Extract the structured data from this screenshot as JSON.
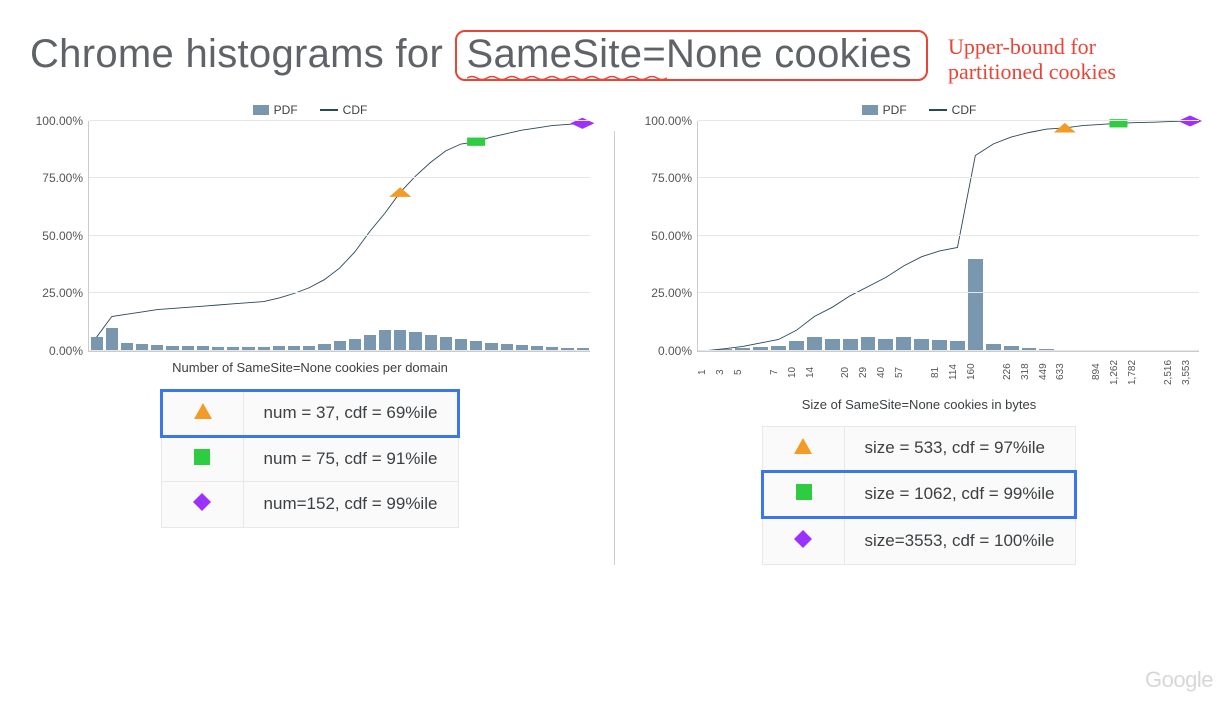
{
  "title_prefix": "Chrome histograms for ",
  "title_box": "SameSite=None cookies",
  "annotation_l1": "Upper-bound for",
  "annotation_l2": "partitioned cookies",
  "legend_pdf": "PDF",
  "legend_cdf": "CDF",
  "left": {
    "subtitle": "Number of SameSite=None cookies per domain",
    "rows": [
      {
        "label": "num = 37, cdf = 69%ile"
      },
      {
        "label": "num = 75, cdf = 91%ile"
      },
      {
        "label": "num=152, cdf = 99%ile"
      }
    ]
  },
  "right": {
    "subtitle": "Size of SameSite=None cookies in bytes",
    "rows": [
      {
        "label": "size = 533, cdf = 97%ile"
      },
      {
        "label": "size = 1062, cdf = 99%ile"
      },
      {
        "label": "size=3553, cdf = 100%ile"
      }
    ]
  },
  "yticks": [
    "0.00%",
    "25.00%",
    "50.00%",
    "75.00%",
    "100.00%"
  ],
  "logo": "Google",
  "chart_data": [
    {
      "type": "bar+line",
      "title": "Number of SameSite=None cookies per domain",
      "ylabel": "%",
      "ylim": [
        0,
        100
      ],
      "series": [
        {
          "name": "PDF",
          "type": "bar",
          "values": [
            6,
            10,
            3.5,
            3,
            2.5,
            2,
            2,
            2,
            1.5,
            1.5,
            1.5,
            1.5,
            2,
            2,
            2,
            3,
            4,
            5,
            7,
            9,
            9,
            8,
            7,
            6,
            5,
            4,
            3.5,
            3,
            2.5,
            2,
            1.5,
            1,
            1
          ]
        },
        {
          "name": "CDF",
          "type": "line",
          "values": [
            6,
            15,
            16,
            17,
            18,
            18.5,
            19,
            19.5,
            20,
            20.5,
            21,
            21.5,
            23,
            25,
            27.5,
            31,
            36,
            43,
            52,
            60,
            69,
            76,
            82,
            87,
            90,
            91,
            93,
            94.5,
            96,
            97,
            98,
            98.5,
            99
          ]
        }
      ],
      "markers": [
        {
          "shape": "triangle",
          "color": "#f29b26",
          "x_index": 20,
          "y": 69,
          "label": "num = 37, cdf = 69%ile"
        },
        {
          "shape": "square",
          "color": "#2ecc40",
          "x_index": 25,
          "y": 91,
          "label": "num = 75, cdf = 91%ile"
        },
        {
          "shape": "diamond",
          "color": "#9b30ff",
          "x_index": 32,
          "y": 99,
          "label": "num=152, cdf = 99%ile"
        }
      ]
    },
    {
      "type": "bar+line",
      "title": "Size of SameSite=None cookies in bytes",
      "ylabel": "%",
      "ylim": [
        0,
        100
      ],
      "categories": [
        "1",
        "3",
        "5",
        "7",
        "10",
        "14",
        "20",
        "29",
        "40",
        "57",
        "81",
        "114",
        "160",
        "226",
        "318",
        "449",
        "633",
        "894",
        "1,262",
        "1,782",
        "2,516",
        "3,553"
      ],
      "series": [
        {
          "name": "PDF",
          "type": "bar",
          "values": [
            0.2,
            0.5,
            1.3,
            1.5,
            2,
            4,
            6,
            5,
            5,
            6,
            5,
            6,
            5,
            4.5,
            4,
            40,
            3,
            2,
            1,
            0.5,
            0.3,
            0.2,
            0.2,
            0.2,
            0.2,
            0.2,
            0.2,
            0.2
          ]
        },
        {
          "name": "CDF",
          "type": "line",
          "values": [
            0.2,
            1,
            2,
            3.5,
            5,
            9,
            15,
            19,
            24,
            28,
            32,
            37,
            41,
            43.5,
            45,
            85,
            90,
            93,
            95,
            96.5,
            97,
            98,
            98.5,
            99,
            99.3,
            99.5,
            99.8,
            100
          ]
        }
      ],
      "markers": [
        {
          "shape": "triangle",
          "color": "#f29b26",
          "x_value": "533-633",
          "y": 97,
          "label": "size = 533, cdf = 97%ile"
        },
        {
          "shape": "square",
          "color": "#2ecc40",
          "x_value": "1062-1262",
          "y": 99,
          "label": "size = 1062, cdf = 99%ile"
        },
        {
          "shape": "diamond",
          "color": "#9b30ff",
          "x_value": "3553",
          "y": 100,
          "label": "size=3553, cdf = 100%ile"
        }
      ]
    }
  ]
}
